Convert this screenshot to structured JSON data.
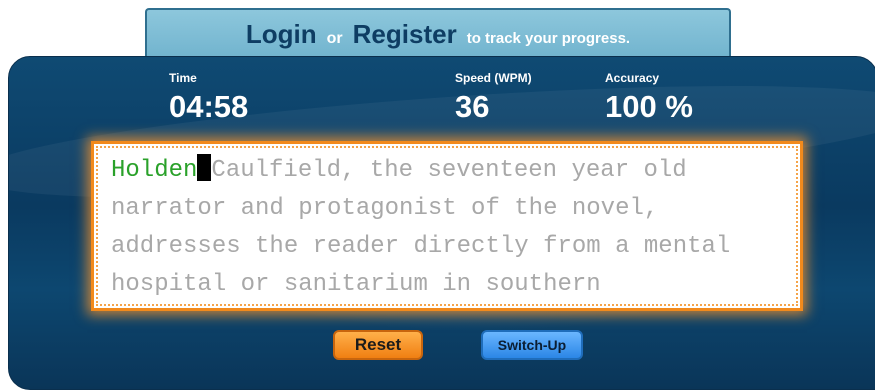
{
  "auth": {
    "login_label": "Login",
    "separator": "or",
    "register_label": "Register",
    "tail_text": "to track your progress."
  },
  "stats": {
    "time_label": "Time",
    "time_value": "04:58",
    "speed_label": "Speed (WPM)",
    "speed_value": "36",
    "accuracy_label": "Accuracy",
    "accuracy_value": "100 %"
  },
  "passage": {
    "typed": "Holden",
    "remaining": "Caulfield, the seventeen year old narrator and protagonist of the novel, addresses the reader directly from a mental hospital or sanitarium in southern"
  },
  "buttons": {
    "reset_label": "Reset",
    "switch_label": "Switch-Up"
  },
  "colors": {
    "panel": "#0a3a60",
    "banner": "#7bbad3",
    "typed_text": "#2aa12a",
    "untyped_text": "#a8a8a8",
    "reset_button": "#f59020",
    "switch_button": "#3d94f0",
    "text_box_border": "#f28a1c"
  }
}
